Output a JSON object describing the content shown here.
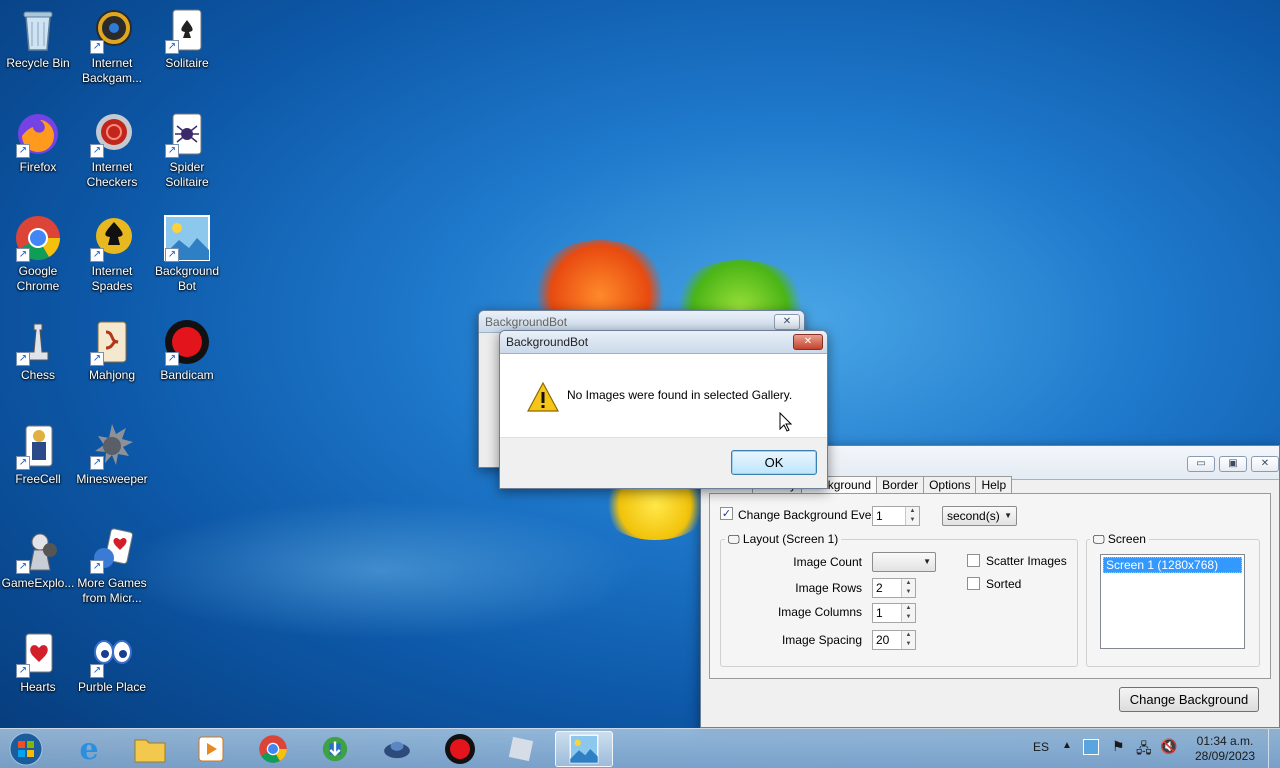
{
  "desktop": {
    "icons": [
      {
        "label": "Recycle Bin",
        "icon": "recycle-bin-icon"
      },
      {
        "label": "Internet Backgam...",
        "icon": "backgammon-icon"
      },
      {
        "label": "Solitaire",
        "icon": "solitaire-icon"
      },
      {
        "label": "Firefox",
        "icon": "firefox-icon"
      },
      {
        "label": "Internet Checkers",
        "icon": "checkers-icon"
      },
      {
        "label": "Spider Solitaire",
        "icon": "spider-solitaire-icon"
      },
      {
        "label": "Google Chrome",
        "icon": "chrome-icon"
      },
      {
        "label": "Internet Spades",
        "icon": "spades-icon"
      },
      {
        "label": "Background Bot",
        "icon": "background-bot-icon"
      },
      {
        "label": "Chess",
        "icon": "chess-icon"
      },
      {
        "label": "Mahjong",
        "icon": "mahjong-icon"
      },
      {
        "label": "Bandicam",
        "icon": "bandicam-icon"
      },
      {
        "label": "FreeCell",
        "icon": "freecell-icon"
      },
      {
        "label": "Minesweeper",
        "icon": "minesweeper-icon"
      },
      {
        "label": "GameExplo...",
        "icon": "game-explorer-icon"
      },
      {
        "label": "More Games from Micr...",
        "icon": "more-games-icon"
      },
      {
        "label": "Hearts",
        "icon": "hearts-icon"
      },
      {
        "label": "Purble Place",
        "icon": "purble-place-icon"
      }
    ]
  },
  "back_window": {
    "title": "BackgroundBot",
    "close": "✕"
  },
  "main_window": {
    "buttons": {
      "minimize": "▭",
      "maximize": "▣",
      "close": "✕"
    },
    "tabs": [
      "Gallery",
      "Background",
      "Border",
      "Options",
      "Help"
    ],
    "change_every": {
      "label": "Change Background Every",
      "checked": true,
      "value": "1",
      "unit": "second(s)"
    },
    "layout": {
      "title": "Layout (Screen 1)",
      "image_count_label": "Image Count",
      "image_count_value": "",
      "image_rows_label": "Image Rows",
      "image_rows_value": "2",
      "image_columns_label": "Image Columns",
      "image_columns_value": "1",
      "image_spacing_label": "Image Spacing",
      "image_spacing_value": "20",
      "scatter_label": "Scatter Images",
      "sorted_label": "Sorted"
    },
    "screen": {
      "title": "Screen",
      "items": [
        "Screen 1 (1280x768)"
      ]
    },
    "change_button": "Change Background"
  },
  "dialog": {
    "title": "BackgroundBot",
    "message": "No Images were found in selected Gallery.",
    "ok": "OK",
    "close": "✕"
  },
  "taskbar": {
    "items": [
      "start-orb",
      "internet-explorer",
      "file-explorer",
      "media-player",
      "chrome",
      "internet-download-manager",
      "game-app",
      "bandicam",
      "inactive-app",
      "background-bot"
    ],
    "language": "ES",
    "time": "01:34 a.m.",
    "date": "28/09/2023"
  },
  "colors": {
    "accent": "#1f79cc",
    "dialog_close": "#c4432c",
    "selection": "#3399ff"
  }
}
